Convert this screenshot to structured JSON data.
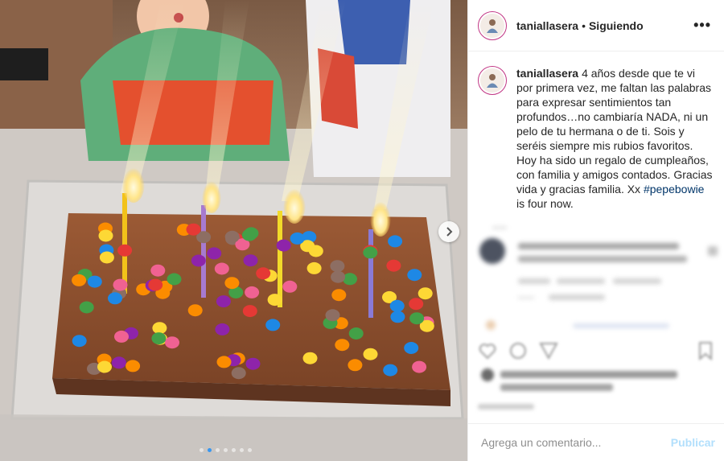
{
  "post": {
    "username": "taniallasera",
    "separator": "•",
    "follow_status": "Siguiendo",
    "more_icon": "•••",
    "caption": {
      "username": "taniallasera",
      "text": "4 años desde que te vi por primera vez, me faltan las palabras para expresar sentimientos tan profundos…no cambiaría NADA, ni un pelo de tu hermana o de ti. Sois y seréis siempre mis rubios favoritos. Hoy ha sido un regalo de cumpleaños, con familia y amigos contados. Gracias vida y gracias familia. Xx",
      "hashtag": "#pepebowie",
      "tail": "is four now."
    }
  },
  "carousel": {
    "next_icon": "chevron-right-icon",
    "total_slides": 7,
    "active_index": 1
  },
  "comment_box": {
    "placeholder": "Agrega un comentario...",
    "publish_label": "Publicar"
  },
  "colors": {
    "link": "#003569",
    "publish_disabled": "#b2dffc",
    "avatar_ring": "#c13584",
    "active_dot": "#3897f0"
  }
}
